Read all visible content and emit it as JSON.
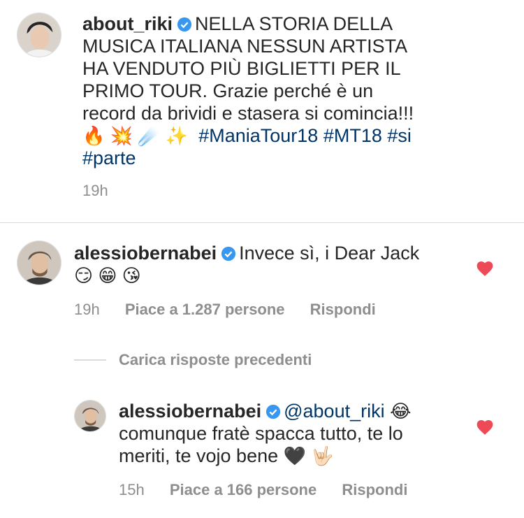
{
  "post": {
    "username": "about_riki",
    "caption_lines": [
      "NELLA STORIA DELLA",
      "MUSICA ITALIANA NESSUN ARTISTA",
      "HA VENDUTO PIÙ BIGLIETTI PER IL",
      "PRIMO TOUR. Grazie perché è un",
      "record da brividi e stasera si comincia!!!"
    ],
    "emojis": "🔥 💥 ☄️ ✨",
    "hashtags": [
      "#ManiaTour18",
      "#MT18",
      "#si",
      "#parte"
    ],
    "time": "19h"
  },
  "comment": {
    "username": "alessiobernabei",
    "text": "Invece sì, i Dear Jack",
    "emojis": "😏 😁 😘",
    "time": "19h",
    "likes": "Piace a 1.287 persone",
    "reply": "Rispondi"
  },
  "load_previous": "Carica risposte precedenti",
  "reply": {
    "username": "alessiobernabei",
    "mention": "@about_riki",
    "emoji1": "😂",
    "line2": "comunque fratè spacca tutto, te lo",
    "line3": "meriti, te vojo bene",
    "emoji2": "🖤 🤟🏻",
    "time": "15h",
    "likes": "Piace a 166 persone",
    "reply": "Rispondi"
  },
  "colors": {
    "link": "#003569",
    "verified": "#3897f0",
    "heart": "#ed4956",
    "muted": "#8e8e8e"
  }
}
